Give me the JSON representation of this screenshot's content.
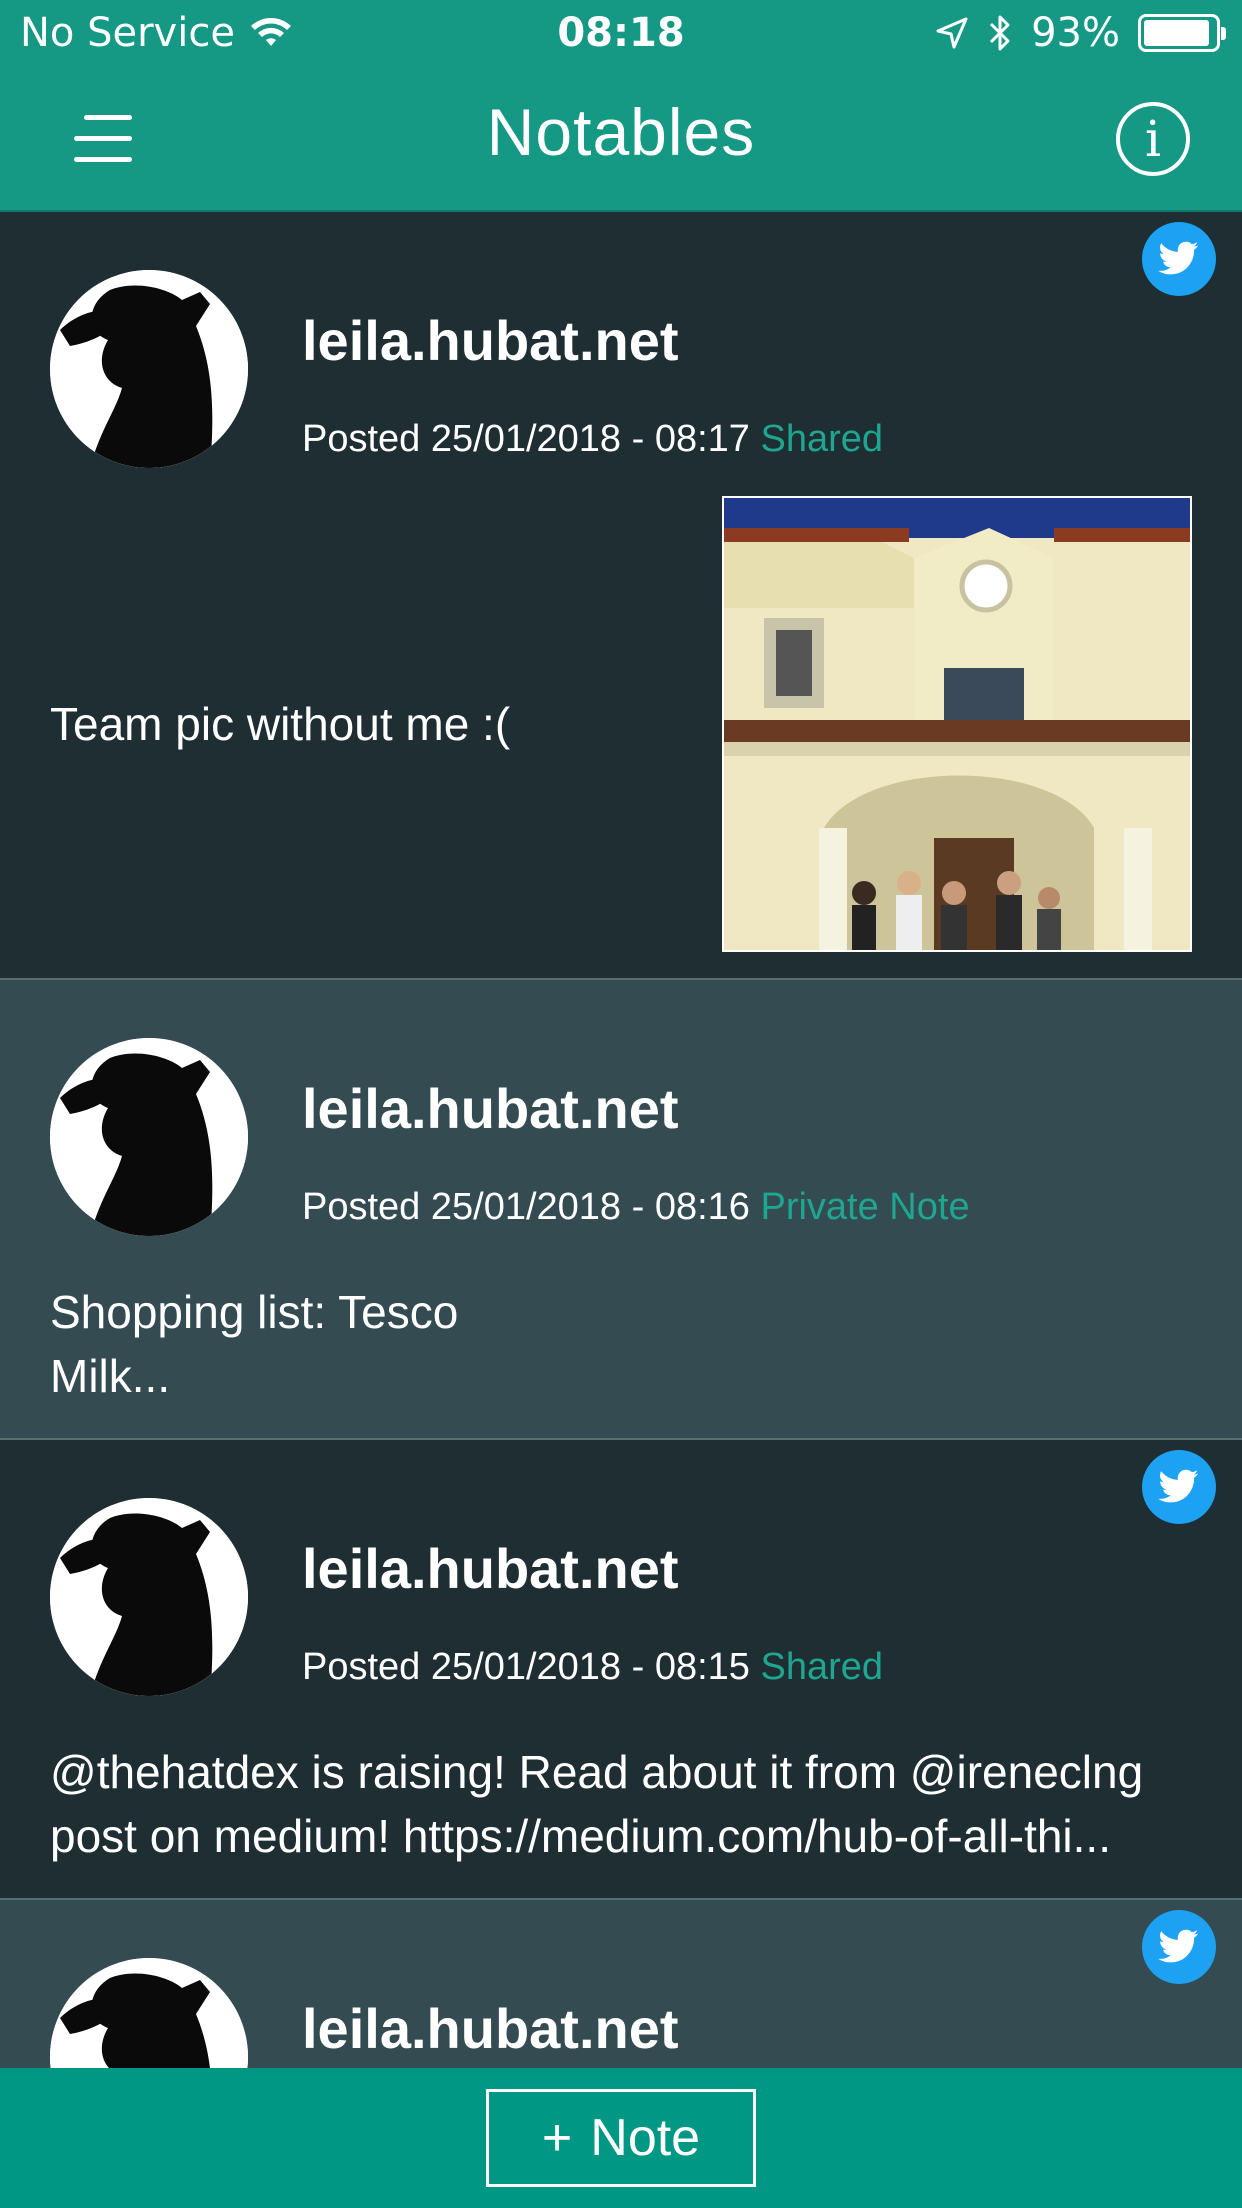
{
  "status_bar": {
    "carrier": "No Service",
    "time": "08:18",
    "battery_percent": "93%",
    "battery_level": 0.93,
    "icons": [
      "wifi-icon",
      "location-arrow-icon",
      "bluetooth-icon",
      "battery-icon"
    ]
  },
  "header": {
    "title": "Notables",
    "menu_icon": "hamburger-menu-icon",
    "info_icon": "info-icon",
    "info_glyph": "i"
  },
  "feed": {
    "posts": [
      {
        "author": "leila.hubat.net",
        "meta": "Posted 25/01/2018 - 08:17",
        "tag": "Shared",
        "body": "Team pic without me :(",
        "has_photo": true,
        "twitter": true
      },
      {
        "author": "leila.hubat.net",
        "meta": "Posted 25/01/2018 - 08:16",
        "tag": "Private Note",
        "body": "Shopping list: Tesco\nMilk...",
        "twitter": false
      },
      {
        "author": "leila.hubat.net",
        "meta": "Posted 25/01/2018 - 08:15",
        "tag": "Shared",
        "body": "@thehatdex is raising! Read about it from @ireneclng post on medium! https://medium.com/hub-of-all-thi...",
        "twitter": true
      },
      {
        "author": "leila.hubat.net",
        "twitter": true
      }
    ]
  },
  "footer": {
    "plus": "+",
    "note_label": "Note"
  },
  "colors": {
    "brand_teal": "#159985",
    "footer_teal": "#009884",
    "tag_teal": "#1ea690",
    "card_dark": "#1f2e33",
    "card_light": "#344b52",
    "twitter_blue": "#1da1f2"
  }
}
